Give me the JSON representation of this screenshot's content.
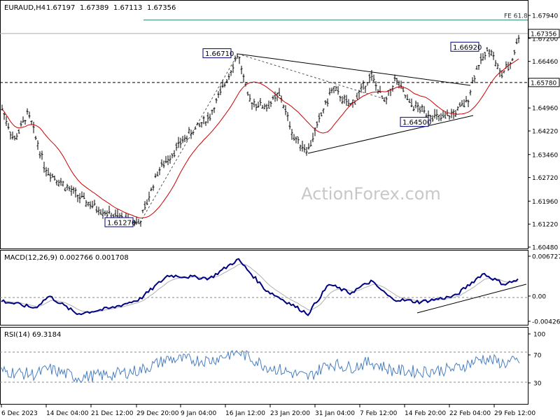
{
  "chart_data": [
    {
      "type": "candlestick",
      "title": "EURAUD,H4",
      "ohlc_header": [
        "1.67197",
        "1.67389",
        "1.67113",
        "1.67356"
      ],
      "yticks": [
        "1.67940",
        "1.67200",
        "1.66460",
        "1.65720",
        "1.64960",
        "1.64220",
        "1.63460",
        "1.62720",
        "1.61960",
        "1.61220",
        "1.60480"
      ],
      "ylim": [
        1.6048,
        1.6794
      ],
      "xticks": [
        "6 Dec 2023",
        "14 Dec 04:00",
        "21 Dec 12:00",
        "29 Dec 20:00",
        "9 Jan 04:00",
        "16 Jan 12:00",
        "23 Jan 20:00",
        "31 Jan 04:00",
        "7 Feb 12:00",
        "14 Feb 20:00",
        "22 Feb 04:00",
        "29 Feb 12:00"
      ],
      "last_price": "1.67356",
      "hline_price": "1.65780",
      "fib_label": "FE 61.8",
      "fib_price": 1.6779,
      "watermark": "ActionForex.com",
      "price_labels": [
        {
          "text": "1.66710",
          "price": 1.6671
        },
        {
          "text": "1.61270",
          "price": 1.6127
        },
        {
          "text": "1.64500",
          "price": 1.645
        },
        {
          "text": "1.66920",
          "price": 1.6692
        }
      ],
      "colors": {
        "price": "#000000",
        "ma": "#cc0000",
        "macd": "#000080",
        "signal": "#b0b0b0",
        "rsi": "#4a7fc1",
        "label_border": "#000080"
      }
    },
    {
      "type": "line",
      "title": "MACD(12,26,9) 0.002766 0.001708",
      "yticks": [
        "0.006727",
        "0.00",
        "-0.00426"
      ],
      "ylim": [
        -0.00426,
        0.006727
      ]
    },
    {
      "type": "line",
      "title": "RSI(14) 69.3184",
      "yticks": [
        "100",
        "70",
        "30",
        "0"
      ],
      "ylim": [
        0,
        100
      ]
    }
  ]
}
